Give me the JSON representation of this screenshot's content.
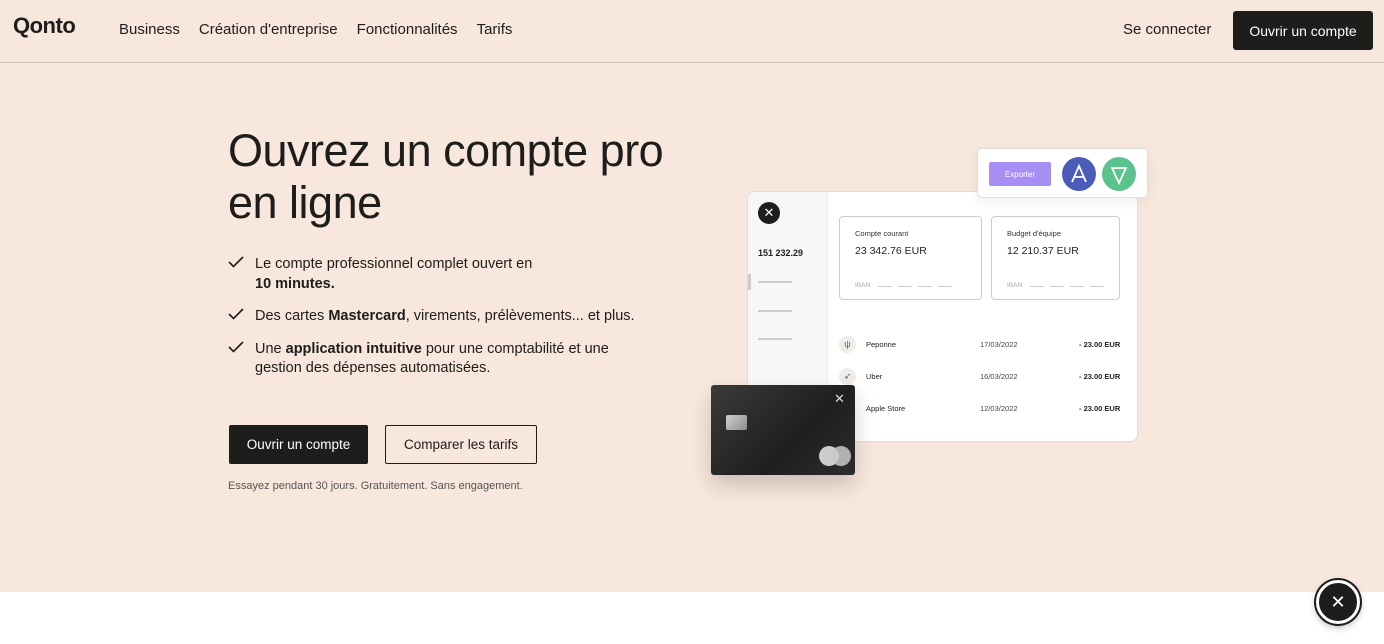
{
  "nav": {
    "logo": "Qonto",
    "links": [
      "Business",
      "Création d'entreprise",
      "Fonctionnalités",
      "Tarifs"
    ],
    "login": "Se connecter",
    "cta": "Ouvrir un compte"
  },
  "hero": {
    "title": "Ouvrez un compte pro en ligne",
    "features": [
      {
        "pre": "Le compte professionnel complet ouvert en ",
        "bold": "10 minutes.",
        "post": ""
      },
      {
        "pre": "Des cartes ",
        "bold": "Mastercard",
        "post": ", virements, prélèvements... et plus."
      },
      {
        "pre": "Une ",
        "bold": "application intuitive",
        "post": " pour une comptabilité et une gestion des dépenses automatisées."
      }
    ],
    "primary_cta": "Ouvrir un compte",
    "secondary_cta": "Comparer les tarifs",
    "trial_note": "Essayez pendant 30 jours. Gratuitement. Sans engagement."
  },
  "illustration": {
    "side_total": "151 232.29",
    "export_label": "Exporter",
    "accounts": [
      {
        "name": "Compte courant",
        "balance": "23 342.76 EUR",
        "iban_label": "IBAN"
      },
      {
        "name": "Budget d'équipe",
        "balance": "12 210.37 EUR",
        "iban_label": "IBAN"
      }
    ],
    "transactions": [
      {
        "icon": "fork-knife-icon",
        "name": "Peponne",
        "date": "17/03/2022",
        "amount": "- 23.00 EUR"
      },
      {
        "icon": "rocket-icon",
        "name": "Uber",
        "date": "16/03/2022",
        "amount": "- 23.00 EUR"
      },
      {
        "icon": "",
        "name": "Apple Store",
        "date": "12/03/2022",
        "amount": "- 23.00 EUR"
      }
    ]
  },
  "colors": {
    "hero_bg": "#f8e7dc",
    "dark": "#1d1d1b",
    "export_purple": "#a78ef2",
    "avatar_blue": "#4a5bb8",
    "avatar_green": "#5cc28d"
  }
}
